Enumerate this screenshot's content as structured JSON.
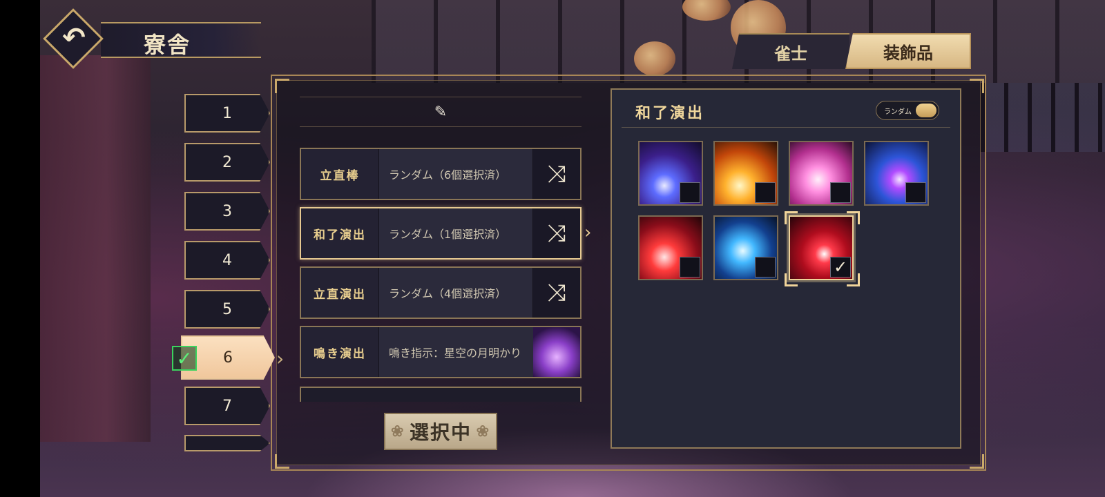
{
  "header": {
    "title": "寮舎",
    "back_icon": "back-arrow-icon"
  },
  "tabs": [
    {
      "label": "雀士",
      "active": false
    },
    {
      "label": "装飾品",
      "active": true
    }
  ],
  "slots": [
    "1",
    "2",
    "3",
    "4",
    "5",
    "6",
    "7"
  ],
  "active_slot": "6",
  "list": {
    "edit_icon": "edit-icon",
    "rows": [
      {
        "label": "立直棒",
        "value": "ランダム（6個選択済）",
        "action_icon": "shuffle-icon"
      },
      {
        "label": "和了演出",
        "value": "ランダム（1個選択済）",
        "action_icon": "shuffle-icon",
        "selected": true
      },
      {
        "label": "立直演出",
        "value": "ランダム（4個選択済）",
        "action_icon": "shuffle-icon"
      },
      {
        "label": "鳴き演出",
        "value": "鳴き指示：星空の月明かり",
        "action_icon": "thumbnail"
      }
    ]
  },
  "select_button": "選択中",
  "panel": {
    "title": "和了演出",
    "random_toggle_label": "ランダム",
    "random_toggle_on": true,
    "tiles_checked": [
      false,
      false,
      false,
      false,
      false,
      false,
      true
    ]
  },
  "colors": {
    "accent": "#c9a86a",
    "panel_bg": "#262837",
    "active_slot": "#f0c79c",
    "check_green": "#3bd35e"
  }
}
